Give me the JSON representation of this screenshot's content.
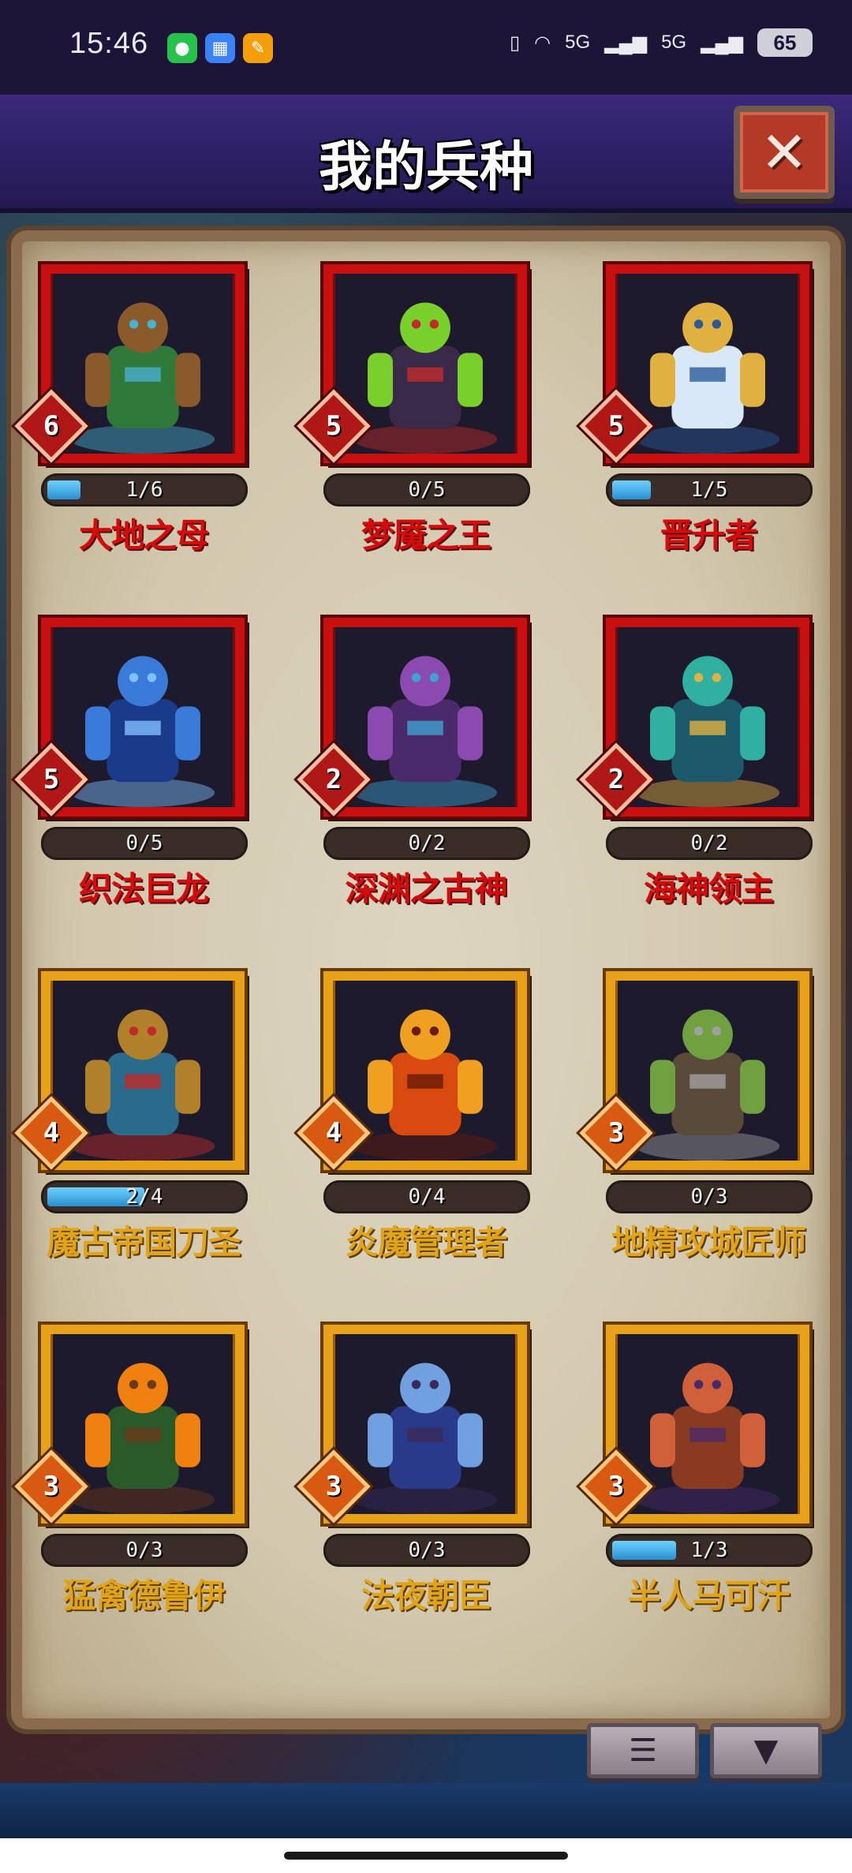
{
  "status_bar": {
    "time": "15:46",
    "app_icons": [
      "wechat-icon",
      "calculator-icon",
      "notes-icon"
    ],
    "signal_label_1": "5G",
    "signal_label_2": "5G",
    "battery": "65"
  },
  "header": {
    "title": "我的兵种",
    "close_symbol": "✕"
  },
  "units": [
    {
      "name": "大地之母",
      "level": "6",
      "progress": "1/6",
      "fill": 0.17,
      "tier": "red"
    },
    {
      "name": "梦魇之王",
      "level": "5",
      "progress": "0/5",
      "fill": 0,
      "tier": "red"
    },
    {
      "name": "晋升者",
      "level": "5",
      "progress": "1/5",
      "fill": 0.2,
      "tier": "red"
    },
    {
      "name": "织法巨龙",
      "level": "5",
      "progress": "0/5",
      "fill": 0,
      "tier": "red"
    },
    {
      "name": "深渊之古神",
      "level": "2",
      "progress": "0/2",
      "fill": 0,
      "tier": "red"
    },
    {
      "name": "海神领主",
      "level": "2",
      "progress": "0/2",
      "fill": 0,
      "tier": "red"
    },
    {
      "name": "魔古帝国刀圣",
      "level": "4",
      "progress": "2/4",
      "fill": 0.5,
      "tier": "gold"
    },
    {
      "name": "炎魔管理者",
      "level": "4",
      "progress": "0/4",
      "fill": 0,
      "tier": "gold"
    },
    {
      "name": "地精攻城匠师",
      "level": "3",
      "progress": "0/3",
      "fill": 0,
      "tier": "gold"
    },
    {
      "name": "猛禽德鲁伊",
      "level": "3",
      "progress": "0/3",
      "fill": 0,
      "tier": "gold"
    },
    {
      "name": "法夜朝臣",
      "level": "3",
      "progress": "0/3",
      "fill": 0,
      "tier": "gold"
    },
    {
      "name": "半人马可汗",
      "level": "3",
      "progress": "1/3",
      "fill": 0.33,
      "tier": "gold"
    }
  ],
  "toolbar": {
    "list_icon": "list-icon",
    "filter_icon": "filter-icon",
    "list_symbol": "☰",
    "filter_symbol": "▼"
  }
}
